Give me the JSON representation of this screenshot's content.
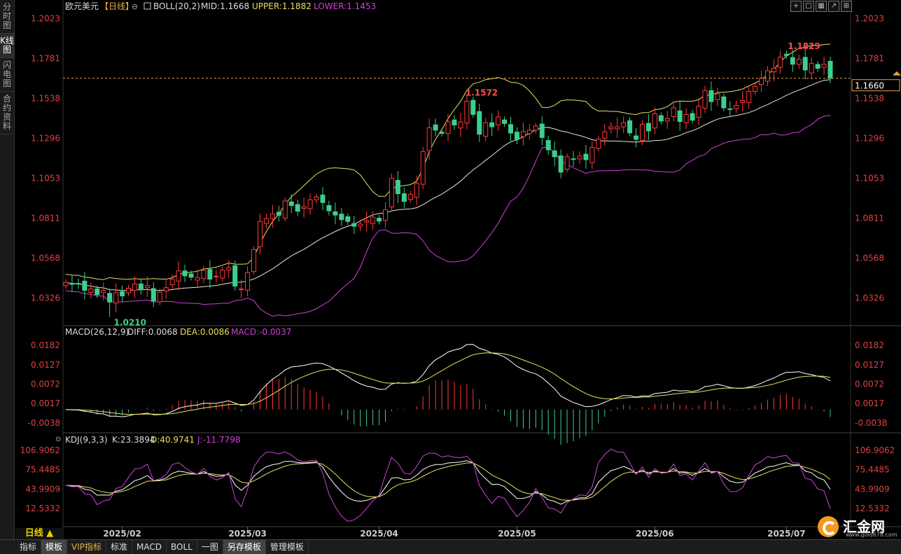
{
  "sidebar": {
    "tabs": [
      "分时图",
      "K线图",
      "闪电图",
      "合约资料"
    ],
    "active": 1
  },
  "header": {
    "symbol": "欧元美元",
    "period_tag": "【日线】",
    "indicator": "BOLL(20,2)",
    "mid": "MID:1.1668",
    "upper": "UPPER:1.1882",
    "lower": "LOWER:1.1453"
  },
  "macd_header": {
    "name": "MACD(26,12,9)",
    "diff": "DIFF:0.0068",
    "dea": "DEA:0.0086",
    "macd": "MACD:-0.0037"
  },
  "kdj_header": {
    "name": "KDJ(9,3,3)",
    "k": "K:23.3894",
    "d": "D:40.9741",
    "j": "J:-11.7798"
  },
  "price_ticks": [
    "1.2023",
    "1.1781",
    "1.1538",
    "1.1296",
    "1.1053",
    "1.0811",
    "1.0568",
    "1.0326"
  ],
  "macd_ticks": [
    "0.0182",
    "0.0127",
    "0.0072",
    "0.0017",
    "-0.0038"
  ],
  "kdj_ticks": [
    "106.9062",
    "75.4485",
    "43.9909",
    "12.5332"
  ],
  "x_ticks": [
    "2025/02",
    "2025/03",
    "2025/04",
    "2025/05",
    "2025/06",
    "2025/07"
  ],
  "annotations": {
    "low": "1.0210",
    "mid_high": "1.1572",
    "high": "1.1829",
    "current": "1.1660"
  },
  "period_button": "日线 ▲",
  "bottom_tabs": [
    "指标",
    "模板",
    "VIP指标",
    "标准",
    "MACD",
    "BOLL",
    "一图",
    "另存模板",
    "管理模板"
  ],
  "logo": {
    "name": "汇金网",
    "url": "www.gold678.com"
  },
  "colors": {
    "up": "#ff3b3b",
    "down": "#3ccf8e",
    "mid": "#e6e6c8",
    "upper": "#e8e060",
    "lower": "#d040d8",
    "k": "#ffffff",
    "d": "#e8e060",
    "j": "#d040d8"
  },
  "chart_data": [
    {
      "type": "candlestick",
      "title": "欧元美元 日线 BOLL(20,2)",
      "x_dates": [
        "2025-01-21",
        "2025-01-22",
        "2025-01-23",
        "2025-01-24",
        "2025-01-27",
        "2025-01-28",
        "2025-01-29",
        "2025-01-30",
        "2025-01-31",
        "2025-02-03",
        "2025-02-04",
        "2025-02-05",
        "2025-02-06",
        "2025-02-07",
        "2025-02-10",
        "2025-02-11",
        "2025-02-12",
        "2025-02-13",
        "2025-02-14",
        "2025-02-17",
        "2025-02-18",
        "2025-02-19",
        "2025-02-20",
        "2025-02-21",
        "2025-02-24",
        "2025-02-25",
        "2025-02-26",
        "2025-02-27",
        "2025-02-28",
        "2025-03-03",
        "2025-03-04",
        "2025-03-05",
        "2025-03-06",
        "2025-03-07",
        "2025-03-10",
        "2025-03-11",
        "2025-03-12",
        "2025-03-13",
        "2025-03-14",
        "2025-03-17",
        "2025-03-18",
        "2025-03-19",
        "2025-03-20",
        "2025-03-21",
        "2025-03-24",
        "2025-03-25",
        "2025-03-26",
        "2025-03-27",
        "2025-03-28",
        "2025-03-31",
        "2025-04-01",
        "2025-04-02",
        "2025-04-03",
        "2025-04-04",
        "2025-04-07",
        "2025-04-08",
        "2025-04-09",
        "2025-04-10",
        "2025-04-11",
        "2025-04-14",
        "2025-04-15",
        "2025-04-16",
        "2025-04-17",
        "2025-04-18",
        "2025-04-21",
        "2025-04-22",
        "2025-04-23",
        "2025-04-24",
        "2025-04-25",
        "2025-04-28",
        "2025-04-29",
        "2025-04-30",
        "2025-05-01",
        "2025-05-02",
        "2025-05-05",
        "2025-05-06",
        "2025-05-07",
        "2025-05-08",
        "2025-05-09",
        "2025-05-12",
        "2025-05-13",
        "2025-05-14",
        "2025-05-15",
        "2025-05-16",
        "2025-05-19",
        "2025-05-20",
        "2025-05-21",
        "2025-05-22",
        "2025-05-23",
        "2025-05-26",
        "2025-05-27",
        "2025-05-28",
        "2025-05-29",
        "2025-05-30",
        "2025-06-02",
        "2025-06-03",
        "2025-06-04",
        "2025-06-05",
        "2025-06-06",
        "2025-06-09",
        "2025-06-10",
        "2025-06-11",
        "2025-06-12",
        "2025-06-13",
        "2025-06-16",
        "2025-06-17",
        "2025-06-18",
        "2025-06-19",
        "2025-06-20",
        "2025-06-23",
        "2025-06-24",
        "2025-06-25",
        "2025-06-26",
        "2025-06-27",
        "2025-06-30",
        "2025-07-01",
        "2025-07-02",
        "2025-07-03",
        "2025-07-04",
        "2025-07-07",
        "2025-07-08",
        "2025-07-09"
      ],
      "close": [
        1.042,
        1.0408,
        1.041,
        1.0372,
        1.0381,
        1.0346,
        1.0372,
        1.0301,
        1.0358,
        1.0338,
        1.0385,
        1.0411,
        1.0376,
        1.0401,
        1.0308,
        1.0362,
        1.0388,
        1.044,
        1.049,
        1.046,
        1.0452,
        1.045,
        1.0493,
        1.044,
        1.0458,
        1.0495,
        1.051,
        1.0398,
        1.038,
        1.048,
        1.062,
        1.079,
        1.0808,
        1.0835,
        1.0828,
        1.0915,
        1.0887,
        1.0852,
        1.088,
        1.0922,
        1.0939,
        1.0905,
        1.0855,
        1.0829,
        1.0801,
        1.079,
        1.0761,
        1.0774,
        1.0796,
        1.0816,
        1.0792,
        1.0861,
        1.1052,
        1.0959,
        1.0912,
        1.0955,
        1.1022,
        1.1215,
        1.1359,
        1.1345,
        1.1325,
        1.1395,
        1.1376,
        1.1394,
        1.152,
        1.144,
        1.132,
        1.139,
        1.1365,
        1.1425,
        1.1385,
        1.1327,
        1.1288,
        1.1336,
        1.1345,
        1.137,
        1.13,
        1.1225,
        1.1183,
        1.109,
        1.1183,
        1.117,
        1.1187,
        1.1165,
        1.124,
        1.129,
        1.1335,
        1.1365,
        1.1365,
        1.139,
        1.1328,
        1.1289,
        1.138,
        1.134,
        1.1445,
        1.14,
        1.1415,
        1.148,
        1.1397,
        1.144,
        1.1405,
        1.149,
        1.1585,
        1.1518,
        1.1565,
        1.148,
        1.147,
        1.1495,
        1.1525,
        1.158,
        1.161,
        1.166,
        1.1705,
        1.172,
        1.1788,
        1.1798,
        1.1745,
        1.1775,
        1.171,
        1.175,
        1.172,
        1.1745,
        1.166
      ],
      "low": 1.021,
      "high": 1.1829,
      "last": 1.166,
      "boll_last": {
        "mid": 1.1668,
        "upper": 1.1882,
        "lower": 1.1453
      },
      "ylim": [
        1.02,
        1.205
      ]
    },
    {
      "type": "bar+line",
      "title": "MACD(26,12,9)",
      "last": {
        "diff": 0.0068,
        "dea": 0.0086,
        "macd": -0.0037
      },
      "ylim": [
        -0.006,
        0.02
      ]
    },
    {
      "type": "line",
      "title": "KDJ(9,3,3)",
      "last": {
        "k": 23.3894,
        "d": 40.9741,
        "j": -11.7798
      },
      "ylim": [
        -15,
        115
      ]
    }
  ]
}
